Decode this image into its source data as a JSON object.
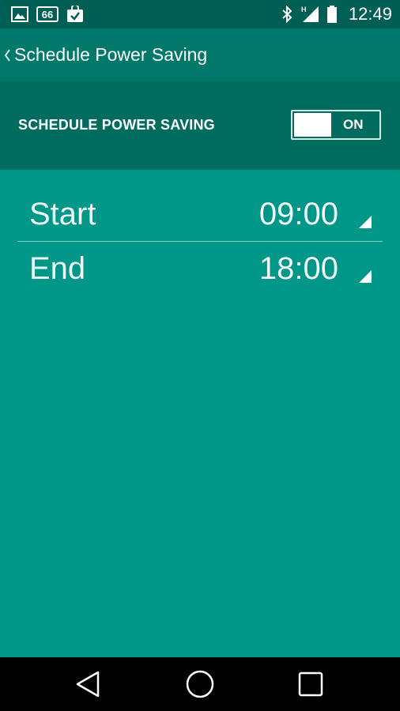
{
  "status_bar": {
    "time": "12:49",
    "left_icons": [
      "image-icon",
      "quote-66-icon",
      "check-bag-icon"
    ],
    "right_icons": [
      "bluetooth-icon",
      "signal-icon",
      "battery-icon"
    ],
    "network_label": "H",
    "notification_badge": "66"
  },
  "app_bar": {
    "title": "Schedule Power Saving",
    "back_icon": "chevron-left-icon"
  },
  "toggle": {
    "label": "SCHEDULE POWER SAVING",
    "state_text": "ON"
  },
  "schedule": [
    {
      "label": "Start",
      "value": "09:00"
    },
    {
      "label": "End",
      "value": "18:00"
    }
  ],
  "nav_bar": {
    "buttons": [
      "back-triangle-icon",
      "home-circle-icon",
      "recents-square-icon"
    ]
  },
  "colors": {
    "status_bar": "#005f55",
    "app_bar": "#00796b",
    "toggle_section": "#006c60",
    "content_bg": "#009688",
    "nav_bar": "#000000"
  }
}
